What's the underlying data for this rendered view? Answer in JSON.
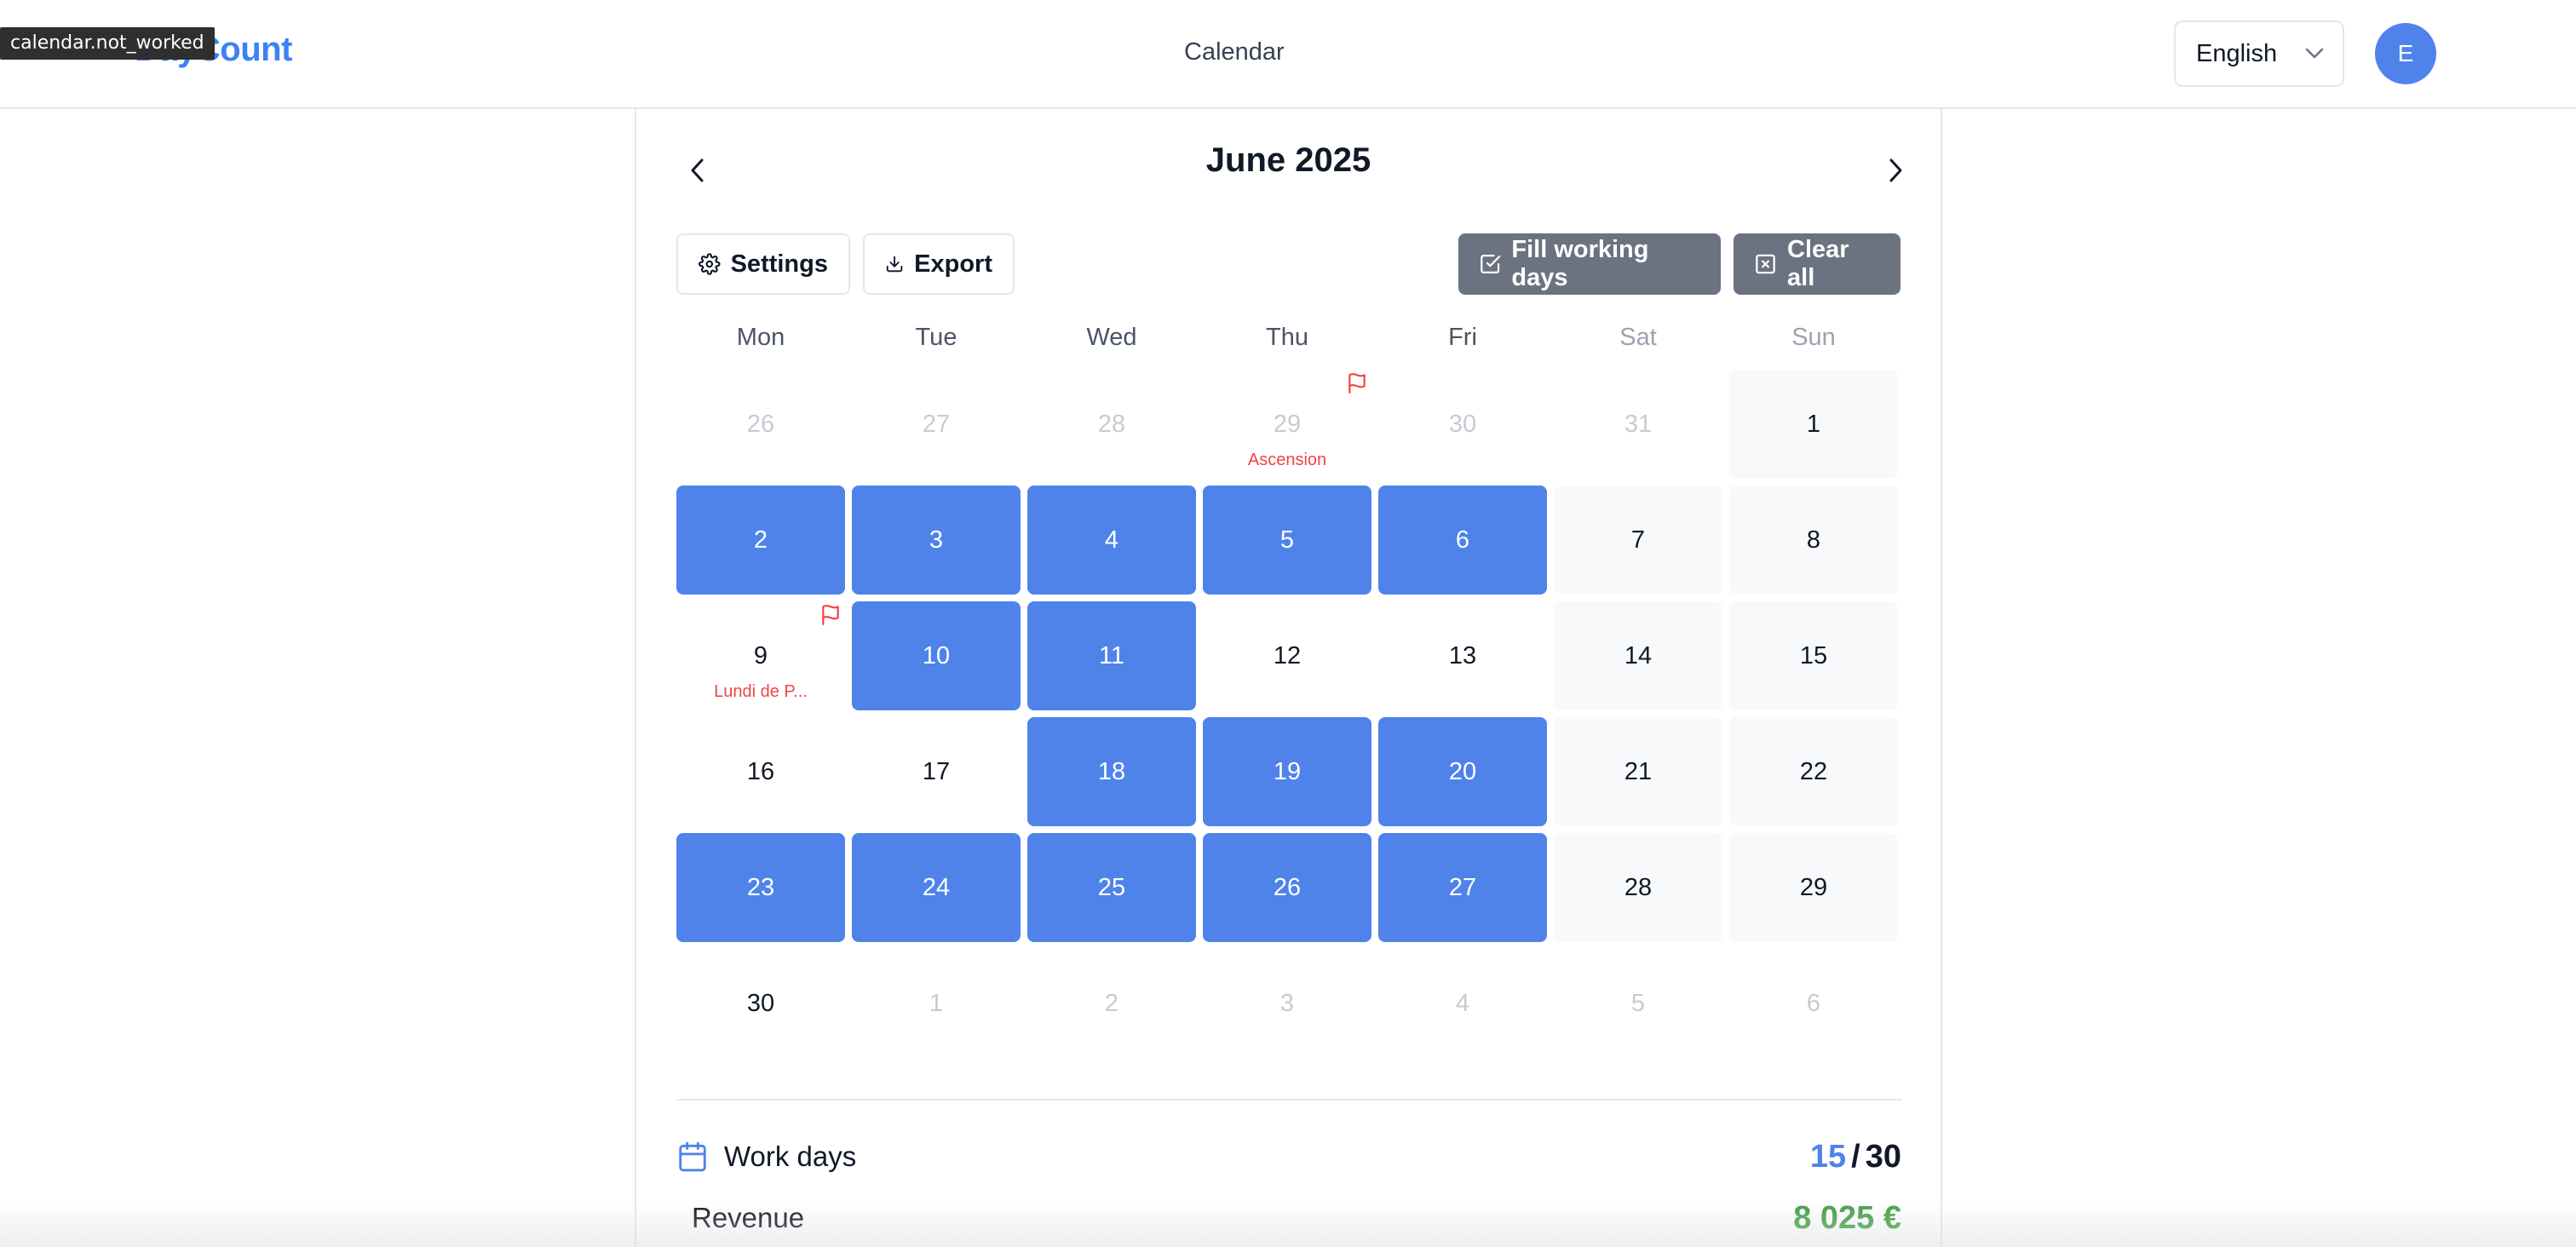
{
  "header": {
    "logo": "DayCount",
    "tooltip": "calendar.not_worked",
    "title": "Calendar",
    "language": "English",
    "avatar_initial": "E"
  },
  "calendar": {
    "month_title": "June 2025",
    "buttons": {
      "settings": "Settings",
      "export": "Export",
      "fill": "Fill working days",
      "clear": "Clear all"
    },
    "weekdays": [
      "Mon",
      "Tue",
      "Wed",
      "Thu",
      "Fri",
      "Sat",
      "Sun"
    ],
    "weeks": [
      [
        {
          "day": "26",
          "state": "other"
        },
        {
          "day": "27",
          "state": "other"
        },
        {
          "day": "28",
          "state": "other"
        },
        {
          "day": "29",
          "state": "other",
          "holiday": "Ascension"
        },
        {
          "day": "30",
          "state": "other"
        },
        {
          "day": "31",
          "state": "other"
        },
        {
          "day": "1",
          "state": "weekend"
        }
      ],
      [
        {
          "day": "2",
          "state": "worked"
        },
        {
          "day": "3",
          "state": "worked"
        },
        {
          "day": "4",
          "state": "worked"
        },
        {
          "day": "5",
          "state": "worked"
        },
        {
          "day": "6",
          "state": "worked"
        },
        {
          "day": "7",
          "state": "weekend"
        },
        {
          "day": "8",
          "state": "weekend"
        }
      ],
      [
        {
          "day": "9",
          "state": "normal",
          "holiday": "Lundi de P..."
        },
        {
          "day": "10",
          "state": "worked"
        },
        {
          "day": "11",
          "state": "worked"
        },
        {
          "day": "12",
          "state": "normal"
        },
        {
          "day": "13",
          "state": "normal"
        },
        {
          "day": "14",
          "state": "weekend"
        },
        {
          "day": "15",
          "state": "weekend"
        }
      ],
      [
        {
          "day": "16",
          "state": "normal"
        },
        {
          "day": "17",
          "state": "normal"
        },
        {
          "day": "18",
          "state": "worked"
        },
        {
          "day": "19",
          "state": "worked"
        },
        {
          "day": "20",
          "state": "worked"
        },
        {
          "day": "21",
          "state": "weekend"
        },
        {
          "day": "22",
          "state": "weekend"
        }
      ],
      [
        {
          "day": "23",
          "state": "worked"
        },
        {
          "day": "24",
          "state": "worked"
        },
        {
          "day": "25",
          "state": "worked"
        },
        {
          "day": "26",
          "state": "worked"
        },
        {
          "day": "27",
          "state": "worked"
        },
        {
          "day": "28",
          "state": "weekend"
        },
        {
          "day": "29",
          "state": "weekend"
        }
      ],
      [
        {
          "day": "30",
          "state": "normal"
        },
        {
          "day": "1",
          "state": "other"
        },
        {
          "day": "2",
          "state": "other"
        },
        {
          "day": "3",
          "state": "other"
        },
        {
          "day": "4",
          "state": "other"
        },
        {
          "day": "5",
          "state": "other"
        },
        {
          "day": "6",
          "state": "other"
        }
      ]
    ]
  },
  "summary": {
    "workdays_label": "Work days",
    "worked": "15",
    "separator": "/",
    "total": "30",
    "revenue_label": "Revenue",
    "revenue": "8 025 €"
  },
  "colors": {
    "accent": "#4f83ea",
    "holiday": "#ef4444",
    "revenue": "#43a047",
    "solid_button": "#6b7280"
  }
}
